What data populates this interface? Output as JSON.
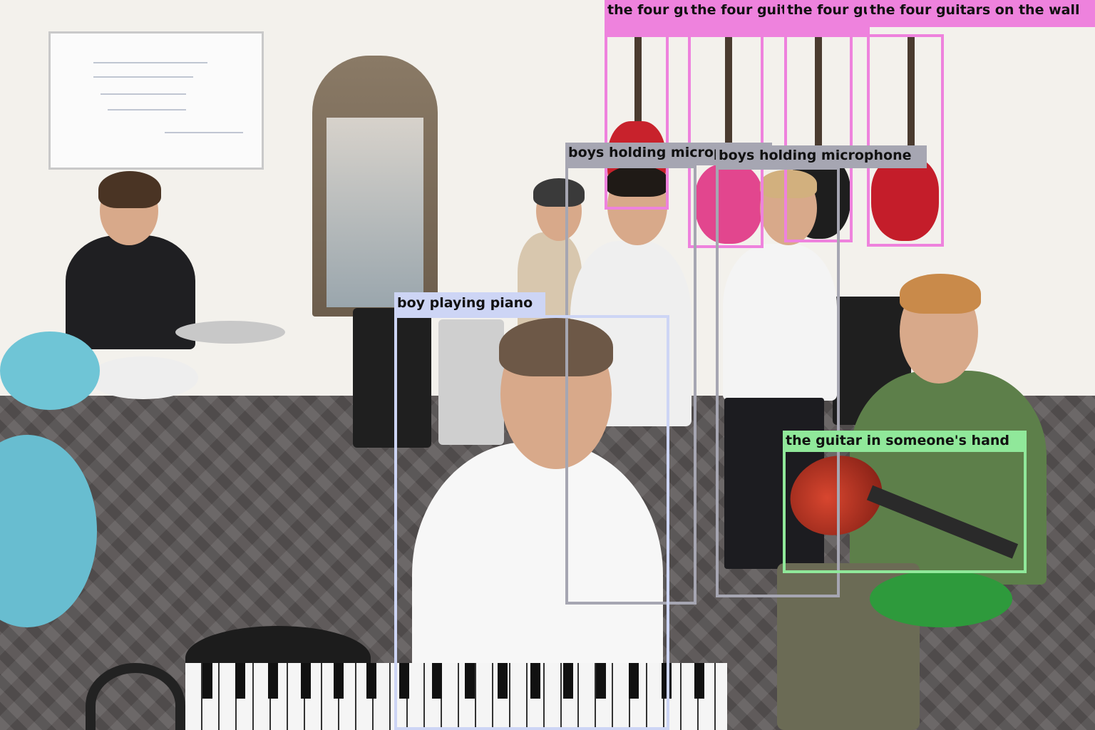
{
  "colors": {
    "guitars": "#ee82dd",
    "microphone": "#a6a6b2",
    "piano": "#cdd5f5",
    "guitar_hand": "#90e89a"
  },
  "annotations": [
    {
      "id": "guitar-1",
      "label": "the four guitars on the wall",
      "color_key": "guitars"
    },
    {
      "id": "guitar-2",
      "label": "the four guitars on the wall",
      "color_key": "guitars"
    },
    {
      "id": "guitar-3",
      "label": "the four guitars on the wall",
      "color_key": "guitars"
    },
    {
      "id": "guitar-4",
      "label": "the four guitars on the wall",
      "color_key": "guitars"
    },
    {
      "id": "mic-1",
      "label": "boys holding microphone",
      "color_key": "microphone"
    },
    {
      "id": "mic-2",
      "label": "boys holding microphone",
      "color_key": "microphone"
    },
    {
      "id": "piano",
      "label": "boy playing piano",
      "color_key": "piano"
    },
    {
      "id": "guitar-hand",
      "label": "the guitar in someone's hand",
      "color_key": "guitar_hand"
    }
  ]
}
